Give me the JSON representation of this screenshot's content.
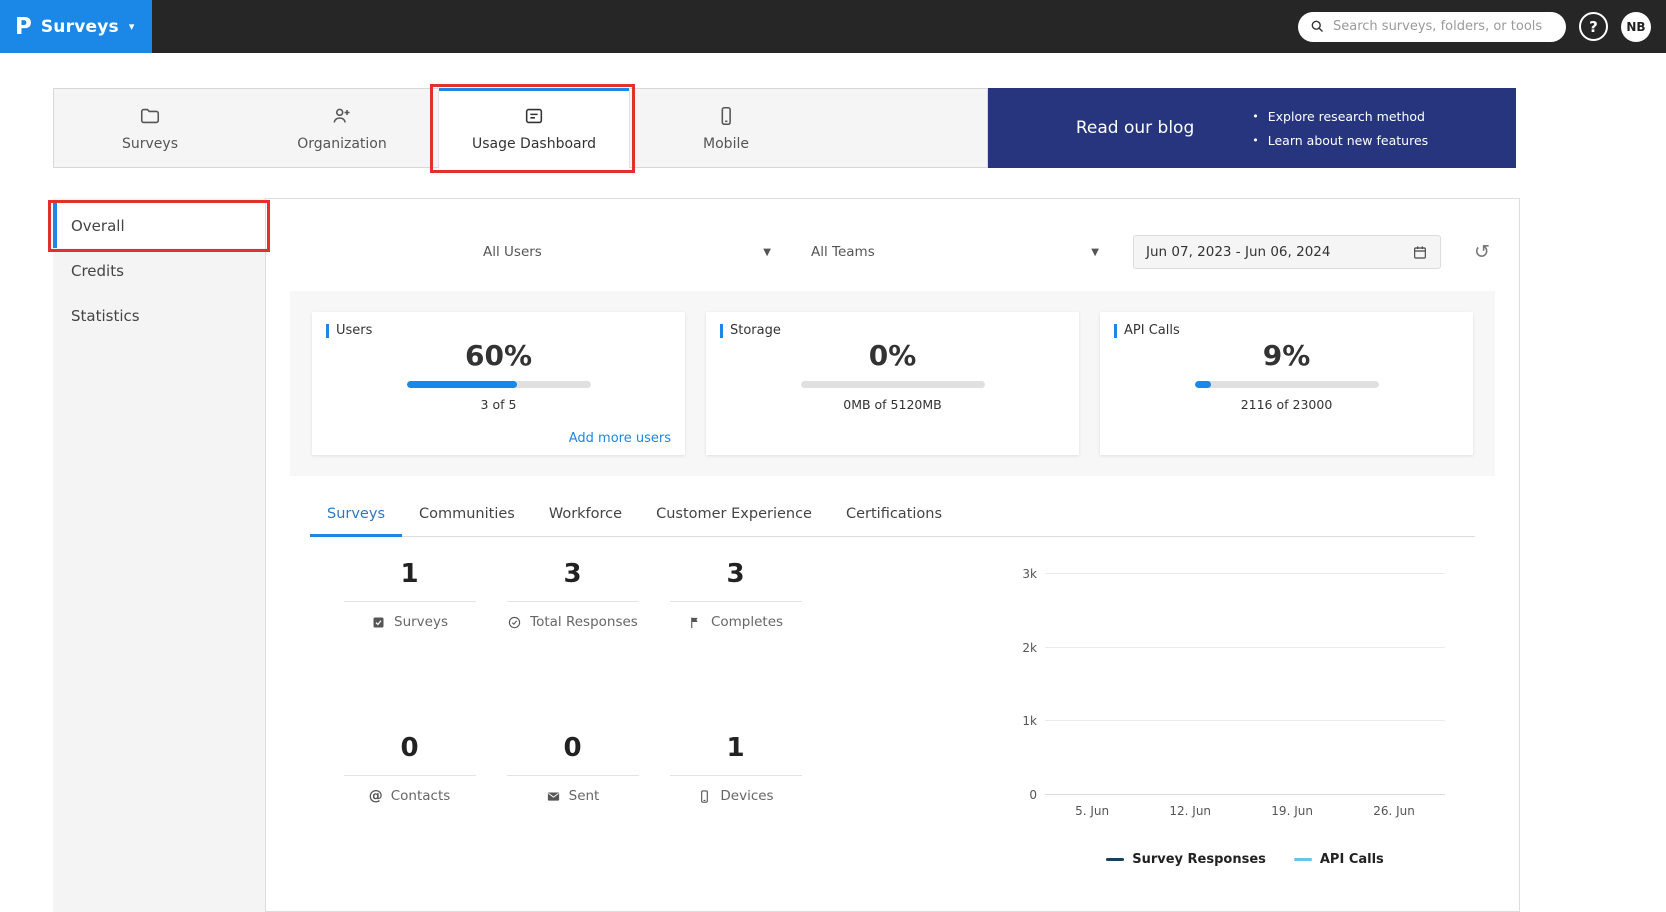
{
  "colors": {
    "brand_blue": "#1b87e6",
    "banner_navy": "#26357d",
    "annotation_red": "#e0312c",
    "topbar_dark": "#262626"
  },
  "topbar": {
    "logo": "P",
    "product_label": "Surveys",
    "search_placeholder": "Search surveys, folders, or tools",
    "help_label": "?",
    "avatar_initials": "NB"
  },
  "nav_tabs": [
    {
      "label": "Surveys",
      "icon": "folder-icon"
    },
    {
      "label": "Organization",
      "icon": "people-icon"
    },
    {
      "label": "Usage Dashboard",
      "icon": "dashboard-icon",
      "active": true
    },
    {
      "label": "Mobile",
      "icon": "mobile-icon"
    }
  ],
  "blog_banner": {
    "title": "Read our blog",
    "bullets": [
      {
        "text": "Explore research method"
      },
      {
        "text": "Learn about new features"
      }
    ]
  },
  "sidebar": {
    "items": [
      {
        "label": "Overall",
        "active": true
      },
      {
        "label": "Credits"
      },
      {
        "label": "Statistics"
      }
    ]
  },
  "filters": {
    "users": "All Users",
    "teams": "All Teams",
    "date_range": "Jun 07, 2023 - Jun 06, 2024",
    "reset_icon": "↺"
  },
  "stat_cards": [
    {
      "title": "Users",
      "percent": "60%",
      "progress": 60,
      "detail": "3 of 5",
      "link": "Add more users"
    },
    {
      "title": "Storage",
      "percent": "0%",
      "progress": 0,
      "detail": "0MB of 5120MB"
    },
    {
      "title": "API Calls",
      "percent": "9%",
      "progress": 9,
      "detail": "2116 of 23000"
    }
  ],
  "usage_tabs": [
    {
      "label": "Surveys",
      "active": true
    },
    {
      "label": "Communities"
    },
    {
      "label": "Workforce"
    },
    {
      "label": "Customer Experience"
    },
    {
      "label": "Certifications"
    }
  ],
  "metrics": [
    {
      "value": "1",
      "label": "Surveys",
      "icon": "checkbox-icon"
    },
    {
      "value": "3",
      "label": "Total Responses",
      "icon": "check-circle-icon"
    },
    {
      "value": "3",
      "label": "Completes",
      "icon": "flag-icon"
    },
    {
      "value": "0",
      "label": "Contacts",
      "icon": "at-icon"
    },
    {
      "value": "0",
      "label": "Sent",
      "icon": "mail-icon"
    },
    {
      "value": "1",
      "label": "Devices",
      "icon": "device-icon"
    }
  ],
  "chart_data": {
    "type": "line",
    "title": "",
    "xlabel": "",
    "ylabel": "",
    "x_ticks": [
      "5. Jun",
      "12. Jun",
      "19. Jun",
      "26. Jun"
    ],
    "y_ticks": [
      "3k",
      "2k",
      "1k",
      "0"
    ],
    "ylim": [
      0,
      3000
    ],
    "grid": true,
    "legend_position": "bottom",
    "series": [
      {
        "name": "Survey Responses",
        "color": "#1c3f5e",
        "values": [
          0,
          0,
          0,
          0
        ]
      },
      {
        "name": "API Calls",
        "color": "#67c3f0",
        "values": [
          0,
          0,
          0,
          0
        ]
      }
    ]
  }
}
